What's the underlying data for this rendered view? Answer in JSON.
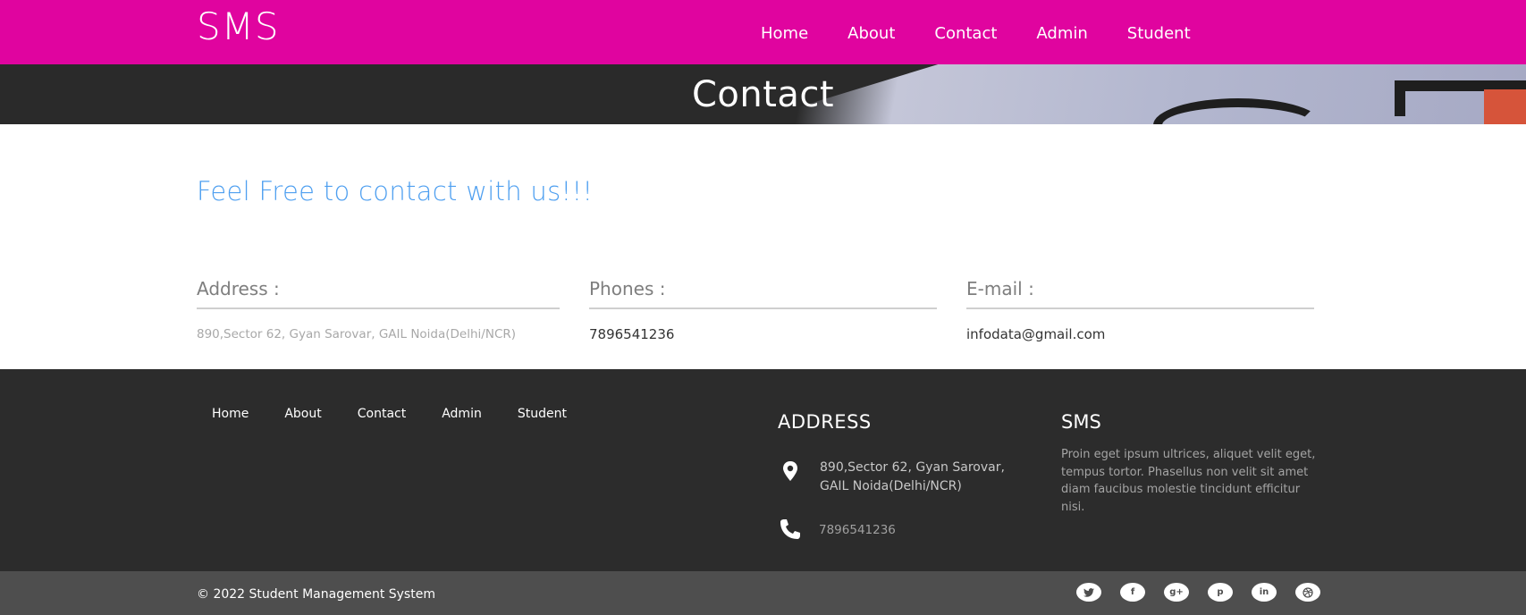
{
  "header": {
    "brand": "SMS",
    "nav": [
      "Home",
      "About",
      "Contact",
      "Admin",
      "Student"
    ]
  },
  "banner": {
    "title": "Contact"
  },
  "main": {
    "tagline": "Feel Free to contact with us!!!",
    "address_label": "Address :",
    "address_value": "890,Sector 62, Gyan Sarovar, GAIL Noida(Delhi/NCR)",
    "phones_label": "Phones :",
    "phones_value": "7896541236",
    "email_label": "E-mail :",
    "email_value": "infodata@gmail.com"
  },
  "footer": {
    "nav": [
      "Home",
      "About",
      "Contact",
      "Admin",
      "Student"
    ],
    "address_heading": "ADDRESS",
    "address_line1": "890,Sector 62, Gyan Sarovar,",
    "address_line2": "GAIL Noida(Delhi/NCR)",
    "phone": "7896541236",
    "sms_heading": "SMS",
    "sms_text": "Proin eget ipsum ultrices, aliquet velit eget, tempus tortor. Phasellus non velit sit amet diam faucibus molestie tincidunt efficitur nisi."
  },
  "bottom": {
    "copyright": "© 2022 Student Management System",
    "socials": [
      {
        "icon": "twitter-icon"
      },
      {
        "icon": "facebook-icon",
        "glyph": "f"
      },
      {
        "icon": "google-plus-icon",
        "glyph": "g+"
      },
      {
        "icon": "pinterest-icon",
        "glyph": "p"
      },
      {
        "icon": "linkedin-icon",
        "glyph": "in"
      },
      {
        "icon": "dribbble-icon"
      }
    ]
  },
  "colors": {
    "header_bg": "#e0049f",
    "tagline": "#4e9ff0",
    "footer_bg": "#2c2c2c",
    "bottom_bg": "#4e4e4e"
  }
}
